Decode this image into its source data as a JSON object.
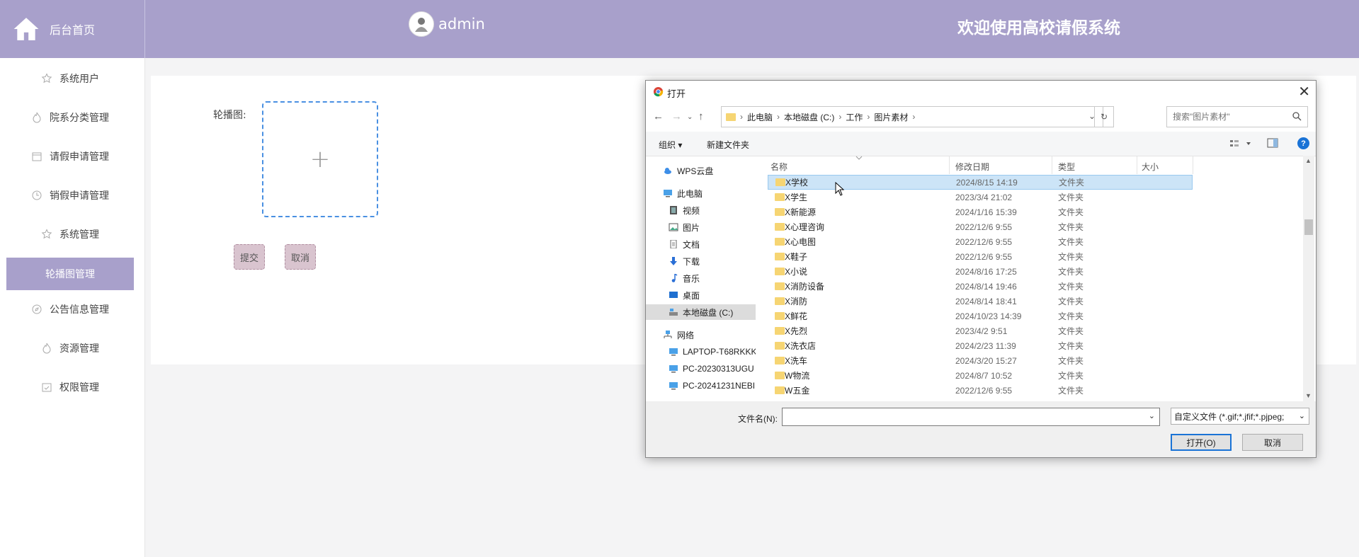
{
  "header": {
    "home_label": "后台首页",
    "username": "admin",
    "site_title": "欢迎使用高校请假系统"
  },
  "sidebar": {
    "items": [
      {
        "label": "系统用户",
        "icon": "star-icon"
      },
      {
        "label": "院系分类管理",
        "icon": "flame-icon"
      },
      {
        "label": "请假申请管理",
        "icon": "calendar-icon"
      },
      {
        "label": "销假申请管理",
        "icon": "clock-icon"
      },
      {
        "label": "系统管理",
        "icon": "star-icon"
      },
      {
        "label": "轮播图管理",
        "icon": "",
        "active": true
      },
      {
        "label": "公告信息管理",
        "icon": "compass-icon"
      },
      {
        "label": "资源管理",
        "icon": "flame-icon"
      },
      {
        "label": "权限管理",
        "icon": "check-calendar-icon"
      }
    ]
  },
  "form": {
    "carousel_label": "轮播图:",
    "upload_plus": "+",
    "submit_label": "提交",
    "cancel_label": "取消"
  },
  "dialog": {
    "title": "打开",
    "close_glyph": "✕",
    "breadcrumb": [
      "此电脑",
      "本地磁盘 (C:)",
      "工作",
      "图片素材"
    ],
    "search_placeholder": "搜索\"图片素材\"",
    "toolbar": {
      "organize": "组织 ▾",
      "new_folder": "新建文件夹"
    },
    "nav_items": [
      {
        "label": "WPS云盘",
        "icon": "cloud-icon",
        "indent": 0
      },
      {
        "label": "此电脑",
        "icon": "computer-icon",
        "indent": 0
      },
      {
        "label": "视频",
        "icon": "video-icon",
        "indent": 1
      },
      {
        "label": "图片",
        "icon": "picture-icon",
        "indent": 1
      },
      {
        "label": "文档",
        "icon": "document-icon",
        "indent": 1
      },
      {
        "label": "下载",
        "icon": "download-icon",
        "indent": 1
      },
      {
        "label": "音乐",
        "icon": "music-icon",
        "indent": 1
      },
      {
        "label": "桌面",
        "icon": "desktop-icon",
        "indent": 1
      },
      {
        "label": "本地磁盘 (C:)",
        "icon": "drive-icon",
        "indent": 1,
        "selected": true
      },
      {
        "label": "网络",
        "icon": "network-icon",
        "indent": 0
      },
      {
        "label": "LAPTOP-T68RKKK",
        "icon": "computer-icon",
        "indent": 1
      },
      {
        "label": "PC-20230313UGU",
        "icon": "computer-icon",
        "indent": 1
      },
      {
        "label": "PC-20241231NEBI",
        "icon": "computer-icon",
        "indent": 1
      }
    ],
    "columns": [
      "名称",
      "修改日期",
      "类型",
      "大小"
    ],
    "files": [
      {
        "name": "X学校",
        "date": "2024/8/15 14:19",
        "type": "文件夹",
        "selected": true
      },
      {
        "name": "X学生",
        "date": "2023/3/4 21:02",
        "type": "文件夹"
      },
      {
        "name": "X新能源",
        "date": "2024/1/16 15:39",
        "type": "文件夹"
      },
      {
        "name": "X心理咨询",
        "date": "2022/12/6 9:55",
        "type": "文件夹"
      },
      {
        "name": "X心电图",
        "date": "2022/12/6 9:55",
        "type": "文件夹"
      },
      {
        "name": "X鞋子",
        "date": "2022/12/6 9:55",
        "type": "文件夹"
      },
      {
        "name": "X小说",
        "date": "2024/8/16 17:25",
        "type": "文件夹"
      },
      {
        "name": "X消防设备",
        "date": "2024/8/14 19:46",
        "type": "文件夹"
      },
      {
        "name": "X消防",
        "date": "2024/8/14 18:41",
        "type": "文件夹"
      },
      {
        "name": "X鲜花",
        "date": "2024/10/23 14:39",
        "type": "文件夹"
      },
      {
        "name": "X先烈",
        "date": "2023/4/2 9:51",
        "type": "文件夹"
      },
      {
        "name": "X洗衣店",
        "date": "2024/2/23 11:39",
        "type": "文件夹"
      },
      {
        "name": "X洗车",
        "date": "2024/3/20 15:27",
        "type": "文件夹"
      },
      {
        "name": "W物流",
        "date": "2024/8/7 10:52",
        "type": "文件夹"
      },
      {
        "name": "W五金",
        "date": "2022/12/6 9:55",
        "type": "文件夹"
      }
    ],
    "filename_label": "文件名(N):",
    "filename_value": "",
    "file_type_filter": "自定义文件 (*.gif;*.jfif;*.pjpeg;",
    "open_label": "打开(O)",
    "cancel_label": "取消"
  }
}
